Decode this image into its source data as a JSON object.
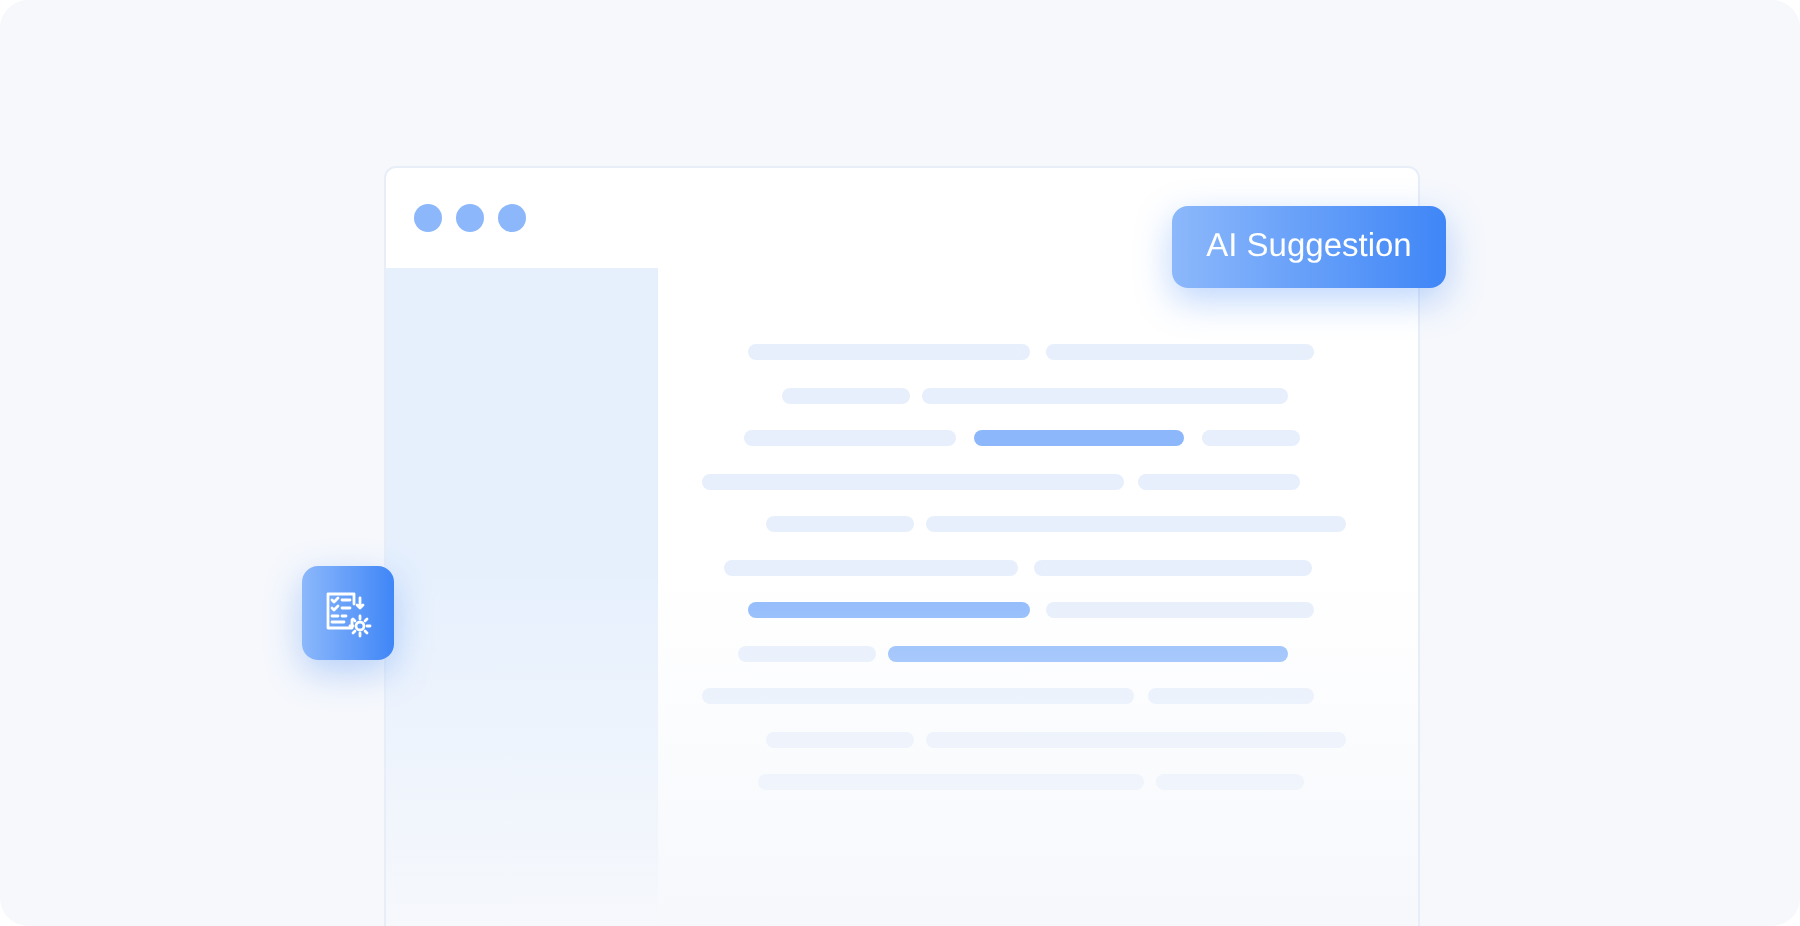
{
  "badge": {
    "label": "AI Suggestion"
  },
  "lines": [
    {
      "segments": [
        {
          "highlighted": false
        },
        {
          "highlighted": false
        }
      ]
    },
    {
      "segments": [
        {
          "highlighted": false
        },
        {
          "highlighted": false
        }
      ]
    },
    {
      "segments": [
        {
          "highlighted": false
        },
        {
          "highlighted": true
        },
        {
          "highlighted": false
        }
      ]
    },
    {
      "segments": [
        {
          "highlighted": false
        },
        {
          "highlighted": false
        }
      ]
    },
    {
      "segments": [
        {
          "highlighted": false
        },
        {
          "highlighted": false
        }
      ]
    },
    {
      "segments": [
        {
          "highlighted": false
        },
        {
          "highlighted": false
        }
      ]
    },
    {
      "segments": [
        {
          "highlighted": true
        },
        {
          "highlighted": false
        }
      ]
    },
    {
      "segments": [
        {
          "highlighted": false
        },
        {
          "highlighted": true
        }
      ]
    },
    {
      "segments": [
        {
          "highlighted": false
        },
        {
          "highlighted": false
        }
      ]
    },
    {
      "segments": [
        {
          "highlighted": false
        },
        {
          "highlighted": false
        }
      ]
    },
    {
      "segments": [
        {
          "highlighted": false
        },
        {
          "highlighted": false
        }
      ]
    }
  ]
}
